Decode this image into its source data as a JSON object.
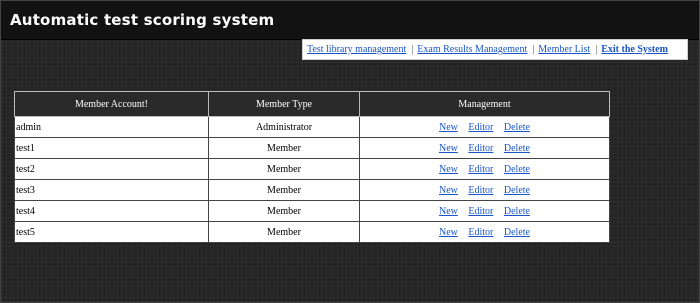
{
  "app": {
    "title": "Automatic test scoring system"
  },
  "nav": {
    "items": [
      {
        "label": "Test library management"
      },
      {
        "label": "Exam Results Management"
      },
      {
        "label": "Member List"
      },
      {
        "label": "Exit the System"
      }
    ],
    "separator": "|"
  },
  "table": {
    "headers": [
      "Member Account!",
      "Member Type",
      "Management"
    ],
    "rows": [
      {
        "account": "admin",
        "type": "Administrator",
        "actions": [
          "New",
          "Editor",
          "Delete"
        ]
      },
      {
        "account": "test1",
        "type": "Member",
        "actions": [
          "New",
          "Editor",
          "Delete"
        ]
      },
      {
        "account": "test2",
        "type": "Member",
        "actions": [
          "New",
          "Editor",
          "Delete"
        ]
      },
      {
        "account": "test3",
        "type": "Member",
        "actions": [
          "New",
          "Editor",
          "Delete"
        ]
      },
      {
        "account": "test4",
        "type": "Member",
        "actions": [
          "New",
          "Editor",
          "Delete"
        ]
      },
      {
        "account": "test5",
        "type": "Member",
        "actions": [
          "New",
          "Editor",
          "Delete"
        ]
      }
    ]
  },
  "colors": {
    "background": "#262626",
    "title_bar": "#121212",
    "link": "#1a55c8",
    "table_header": "#2a2a2a"
  }
}
